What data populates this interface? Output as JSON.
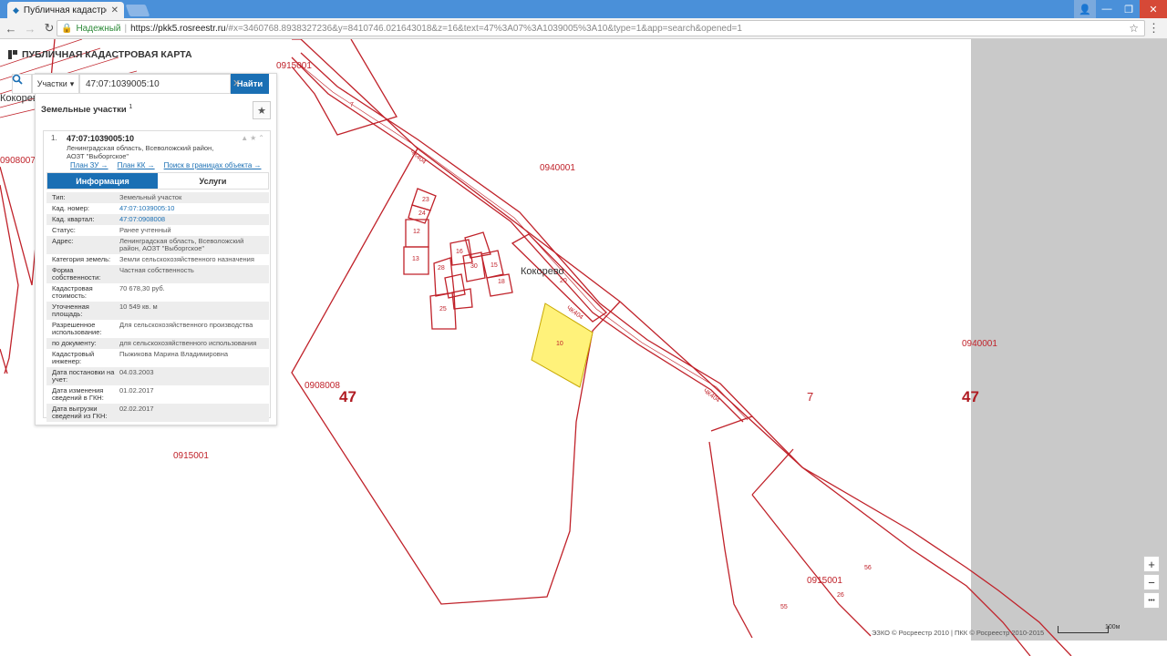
{
  "browser": {
    "tab_title": "Публичная кадастрова",
    "tab_close": "✕",
    "secure_label": "Надежный",
    "url_host": "https://pkk5.rosreestr.ru",
    "url_rest": "/#x=3460768.8938327236&y=8410746.021643018&z=16&text=47%3A07%3A1039005%3A10&type=1&app=search&opened=1"
  },
  "app": {
    "logo_title": "ПУБЛИЧНАЯ КАДАСТРОВАЯ КАРТА"
  },
  "search": {
    "type_label": "Участки",
    "query": "47:07:1039005:10",
    "find_label": "Найти"
  },
  "results": {
    "title": "Земельные участки",
    "count": "1"
  },
  "card": {
    "index": "1.",
    "cad_number": "47:07:1039005:10",
    "address": "Ленинградская область, Всеволожский район, АОЗТ \"Выборгское\"",
    "links": [
      "План ЗУ →",
      "План КК →",
      "Поиск в границах объекта →"
    ],
    "tabs": [
      "Информация",
      "Услуги"
    ],
    "properties": [
      {
        "k": "Тип:",
        "v": "Земельный участок"
      },
      {
        "k": "Кад. номер:",
        "v": "47:07:1039005:10"
      },
      {
        "k": "Кад. квартал:",
        "v": "47:07:0908008"
      },
      {
        "k": "Статус:",
        "v": "Ранее учтенный"
      },
      {
        "k": "Адрес:",
        "v": "Ленинградская область, Всеволожский район, АОЗТ \"Выборгское\""
      },
      {
        "k": "Категория земель:",
        "v": "Земли сельскохозяйственного назначения"
      },
      {
        "k": "Форма собственности:",
        "v": "Частная собственность"
      },
      {
        "k": "Кадастровая стоимость:",
        "v": "70 678,30 руб."
      },
      {
        "k": "Уточненная площадь:",
        "v": "10 549 кв. м"
      },
      {
        "k": "Разрешенное использование:",
        "v": "Для сельскохозяйственного производства"
      },
      {
        "k": "по документу:",
        "v": "для сельскохозяйственного использования"
      },
      {
        "k": "Кадастровый инженер:",
        "v": "Пыжикова Марина Владимировна"
      },
      {
        "k": "Дата постановки на учет:",
        "v": "04.03.2003"
      },
      {
        "k": "Дата изменения сведений в ГКН:",
        "v": "01.02.2017"
      },
      {
        "k": "Дата выгрузки сведений из ГКН:",
        "v": "02.02.2017"
      }
    ]
  },
  "map_labels": {
    "q0915001_top": "0915001",
    "q0908007": "0908007",
    "q0940001": "0940001",
    "q0940001_right": "0940001",
    "q0908008": "0908008",
    "q0915001_bottom": "0915001",
    "q0915001_lower": "0915001",
    "region_47a": "47",
    "region_47b": "47",
    "district_7": "7",
    "place_kokorevo": "Кокорево",
    "place_kokorevo_left": "Кокорево",
    "road_label": "ЧК404"
  },
  "parcel_numbers": {
    "p10": "10",
    "p20": "20",
    "p23": "23",
    "p24": "24",
    "p12": "12",
    "p13": "13",
    "p25": "25",
    "p16": "16",
    "p15": "15",
    "p18": "18",
    "p30": "30",
    "p28": "28",
    "p56": "56",
    "p55": "55",
    "p26": "26",
    "p7": "7"
  },
  "map_controls": {
    "zoom_in": "+",
    "zoom_out": "−",
    "more": "•••",
    "attribution": "ЭЗКО © Росреестр 2010 | ПКК © Росреестр 2010-2015",
    "scale": "100м"
  },
  "colors": {
    "boundary": "#c0222a",
    "selected_parcel": "#fff27a",
    "accent": "#1a6fb4"
  }
}
